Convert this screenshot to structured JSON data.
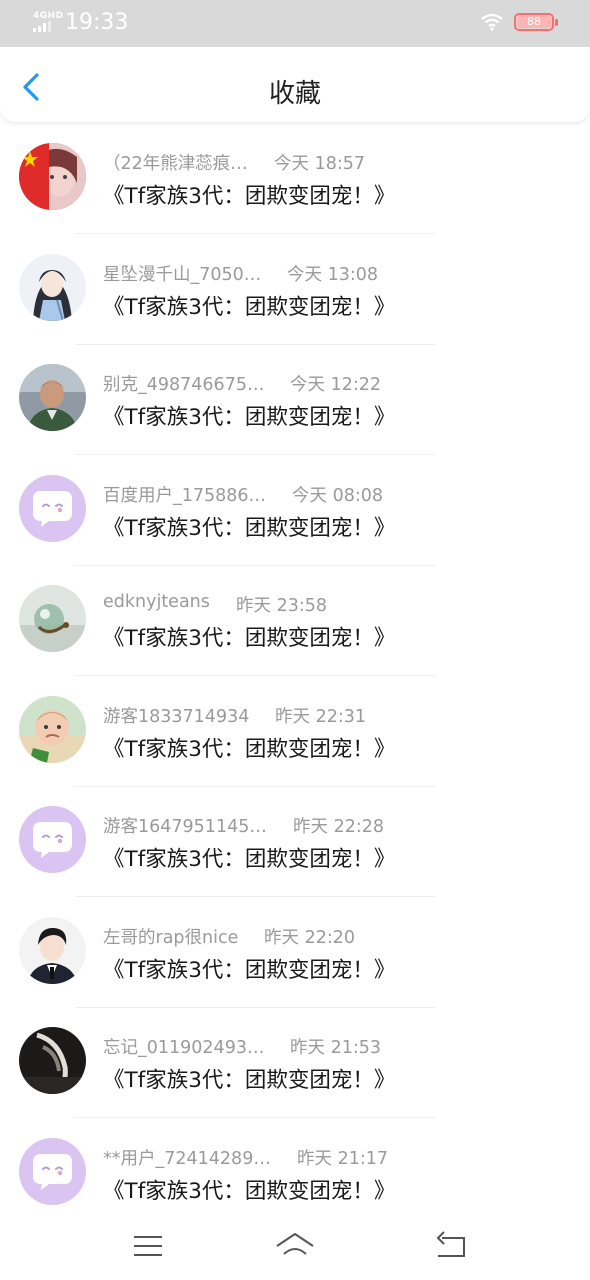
{
  "status": {
    "network": "4GHD",
    "time": "19:33",
    "battery": "88"
  },
  "header": {
    "title": "收藏"
  },
  "items": [
    {
      "name": "（22年熊津蕊痕…",
      "time": "今天 18:57",
      "title": "《Tf家族3代：团欺变团宠！》",
      "avatar": "flag-girl"
    },
    {
      "name": "星坠漫千山_7050…",
      "time": "今天 13:08",
      "title": "《Tf家族3代：团欺变团宠！》",
      "avatar": "anime-girl"
    },
    {
      "name": "别克_498746675…",
      "time": "今天 12:22",
      "title": "《Tf家族3代：团欺变团宠！》",
      "avatar": "man-photo"
    },
    {
      "name": "百度用户_175886…",
      "time": "今天 08:08",
      "title": "《Tf家族3代：团欺变团宠！》",
      "avatar": "default"
    },
    {
      "name": "edknyjteans",
      "time": "昨天 23:58",
      "title": "《Tf家族3代：团欺变团宠！》",
      "avatar": "glass-orb"
    },
    {
      "name": "游客1833714934",
      "time": "昨天 22:31",
      "title": "《Tf家族3代：团欺变团宠！》",
      "avatar": "baby"
    },
    {
      "name": "游客1647951145…",
      "time": "昨天 22:28",
      "title": "《Tf家族3代：团欺变团宠！》",
      "avatar": "default"
    },
    {
      "name": "左哥的rap很nice",
      "time": "昨天 22:20",
      "title": "《Tf家族3代：团欺变团宠！》",
      "avatar": "boy-suit"
    },
    {
      "name": "忘记_011902493…",
      "time": "昨天 21:53",
      "title": "《Tf家族3代：团欺变团宠！》",
      "avatar": "dark-photo"
    },
    {
      "name": "**用户_72414289…",
      "time": "昨天 21:17",
      "title": "《Tf家族3代：团欺变团宠！》",
      "avatar": "default"
    }
  ],
  "icons": {
    "back": "chevron-left-icon",
    "menu": "menu-icon",
    "home": "home-icon",
    "return": "return-icon"
  },
  "colors": {
    "accent": "#1f9bf0",
    "default_avatar": "#d9c4f2",
    "battery_border": "#ff6b6b"
  }
}
